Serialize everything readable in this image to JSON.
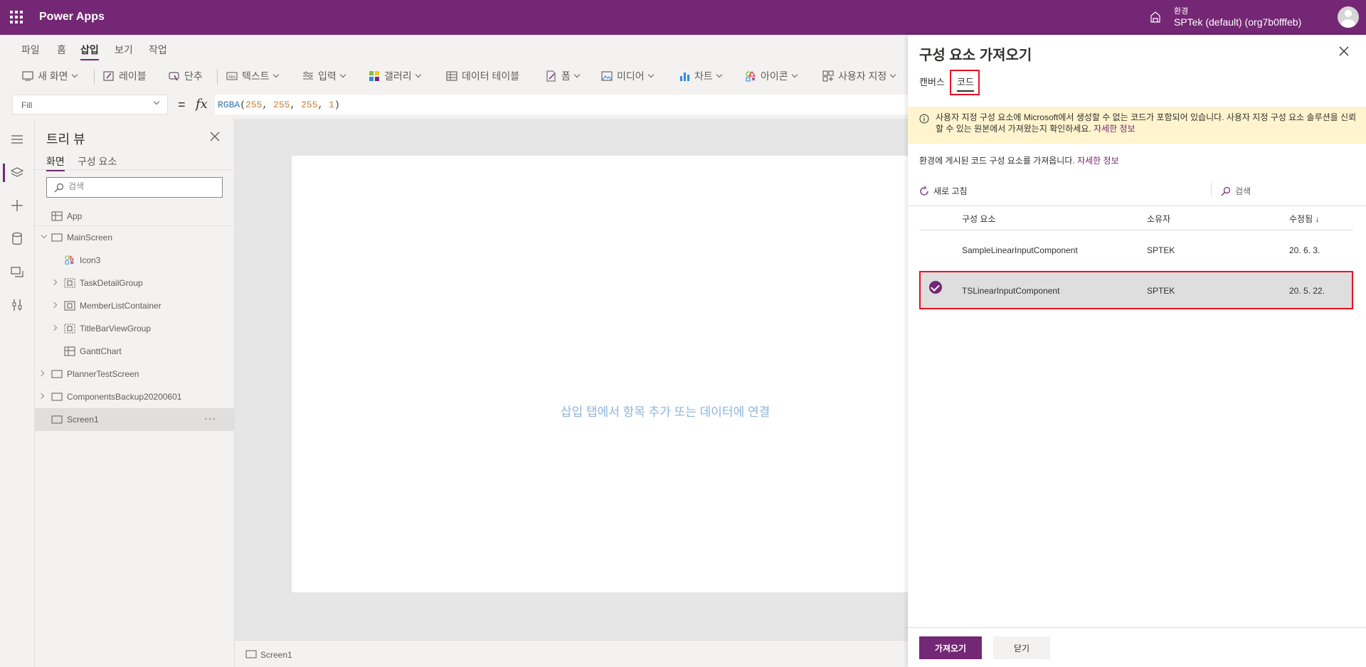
{
  "app": {
    "name": "Power Apps"
  },
  "environment": {
    "label": "환경",
    "name": "SPTek (default) (org7b0fffeb)"
  },
  "menu": {
    "tabs": [
      "파일",
      "홈",
      "삽입",
      "보기",
      "작업"
    ],
    "active": "삽입"
  },
  "ribbon": {
    "items": [
      {
        "label": "새 화면",
        "icon": "new-screen-icon"
      },
      {
        "label": "레이블",
        "icon": "label-icon"
      },
      {
        "label": "단추",
        "icon": "button-icon"
      },
      {
        "label": "텍스트",
        "icon": "text-icon"
      },
      {
        "label": "입력",
        "icon": "input-icon"
      },
      {
        "label": "갤러리",
        "icon": "gallery-icon"
      },
      {
        "label": "데이터 테이블",
        "icon": "data-table-icon"
      },
      {
        "label": "폼",
        "icon": "form-icon"
      },
      {
        "label": "미디어",
        "icon": "media-icon"
      },
      {
        "label": "차트",
        "icon": "chart-icon"
      },
      {
        "label": "아이콘",
        "icon": "icons-icon"
      },
      {
        "label": "사용자 지정",
        "icon": "custom-icon"
      }
    ]
  },
  "formula": {
    "property": "Fill",
    "equals": "=",
    "fx": "fx",
    "fn": "RGBA",
    "args": [
      "255",
      "255",
      "255",
      "1"
    ]
  },
  "treeview": {
    "title": "트리 뷰",
    "tabs": [
      "화면",
      "구성 요소"
    ],
    "search_placeholder": "검색",
    "app_item": "App",
    "items": [
      {
        "label": "MainScreen",
        "expanded": true,
        "level": 0,
        "type": "screen"
      },
      {
        "label": "Icon3",
        "level": 1,
        "type": "icon"
      },
      {
        "label": "TaskDetailGroup",
        "level": 1,
        "type": "group",
        "expandable": true
      },
      {
        "label": "MemberListContainer",
        "level": 1,
        "type": "container",
        "expandable": true
      },
      {
        "label": "TitleBarViewGroup",
        "level": 1,
        "type": "group",
        "expandable": true
      },
      {
        "label": "GanttChart",
        "level": 1,
        "type": "component"
      },
      {
        "label": "PlannerTestScreen",
        "level": 0,
        "type": "screen",
        "expandable": true
      },
      {
        "label": "ComponentsBackup20200601",
        "level": 0,
        "type": "screen",
        "expandable": true
      },
      {
        "label": "Screen1",
        "level": 0,
        "type": "screen",
        "selected": true
      }
    ],
    "more": "···"
  },
  "canvas": {
    "hint": "삽입 탭에서 항목 추가 또는 데이터에 연결"
  },
  "status": {
    "screen": "Screen1"
  },
  "panel": {
    "title": "구성 요소 가져오기",
    "tabs": [
      "캔버스",
      "코드"
    ],
    "active_tab": "코드",
    "warning": "사용자 지정 구성 요소에 Microsoft에서 생성할 수 없는 코드가 포함되어 있습니다. 사용자 지정 구성 요소 솔루션을 신뢰할 수 있는 원본에서 가져왔는지 확인하세요.",
    "warning_link": "자세한 정보",
    "description": "환경에 게시된 코드 구성 요소를 가져옵니다.",
    "description_link": "자세한 정보",
    "refresh": "새로 고침",
    "search": "검색",
    "columns": [
      "구성 요소",
      "소유자",
      "수정됨 ↓"
    ],
    "rows": [
      {
        "name": "SampleLinearInputComponent",
        "owner": "SPTEK",
        "modified": "20. 6. 3.",
        "selected": false
      },
      {
        "name": "TSLinearInputComponent",
        "owner": "SPTEK",
        "modified": "20. 5. 22.",
        "selected": true
      }
    ],
    "import_button": "가져오기",
    "close_button": "닫기"
  },
  "colors": {
    "brand": "#742774",
    "warning_bg": "#fff4ce",
    "highlight": "#e81123"
  }
}
